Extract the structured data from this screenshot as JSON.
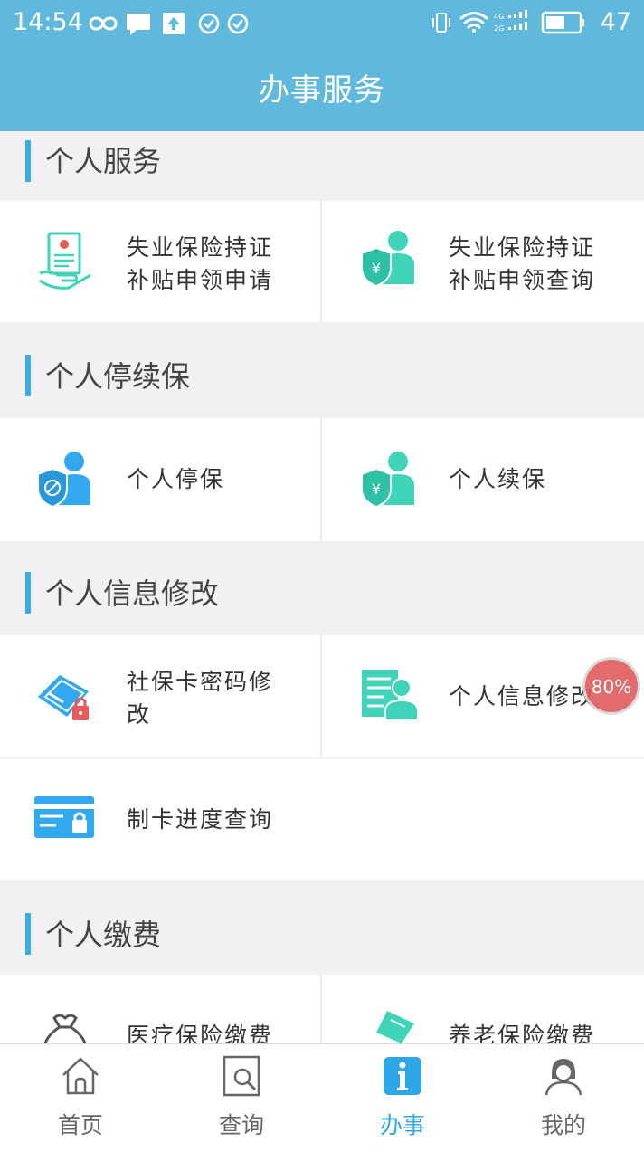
{
  "status_bar": {
    "time": "14:54",
    "battery": "47",
    "network": "4G"
  },
  "header": {
    "title": "办事服务"
  },
  "sections": [
    {
      "title": "个人服务",
      "tiles": [
        {
          "label_line1": "失业保险持证",
          "label_line2": "补贴申领申请",
          "icon": "certificate-hand-icon"
        },
        {
          "label_line1": "失业保险持证",
          "label_line2": "补贴申领查询",
          "icon": "person-shield-yuan-icon"
        }
      ]
    },
    {
      "title": "个人停续保",
      "tiles": [
        {
          "label": "个人停保",
          "icon": "person-shield-stop-icon"
        },
        {
          "label": "个人续保",
          "icon": "person-shield-yuan-icon"
        }
      ]
    },
    {
      "title": "个人信息修改",
      "tiles": [
        {
          "label_line1": "社保卡密码修",
          "label_line2": "改",
          "icon": "card-lock-icon"
        },
        {
          "label": "个人信息修改",
          "icon": "person-document-icon"
        },
        {
          "label": "制卡进度查询",
          "icon": "card-progress-lock-icon"
        }
      ]
    },
    {
      "title": "个人缴费",
      "tiles": [
        {
          "label": "医疗保险缴费",
          "icon": "money-bag-icon"
        },
        {
          "label": "养老保险缴费",
          "icon": "hand-money-icon"
        }
      ]
    }
  ],
  "floating_bubble": {
    "text": "80%"
  },
  "bottom_nav": {
    "active_index": 2,
    "items": [
      {
        "label": "首页",
        "icon": "home-icon"
      },
      {
        "label": "查询",
        "icon": "search-document-icon"
      },
      {
        "label": "办事",
        "icon": "info-icon"
      },
      {
        "label": "我的",
        "icon": "user-icon"
      }
    ]
  },
  "colors": {
    "header": "#60b9dd",
    "accent_bar": "#3aabe8",
    "teal_icon": "#3fd3b8",
    "blue_icon": "#32a8ee",
    "nav_active": "#2ea7e8",
    "background": "#f1f1f1"
  }
}
